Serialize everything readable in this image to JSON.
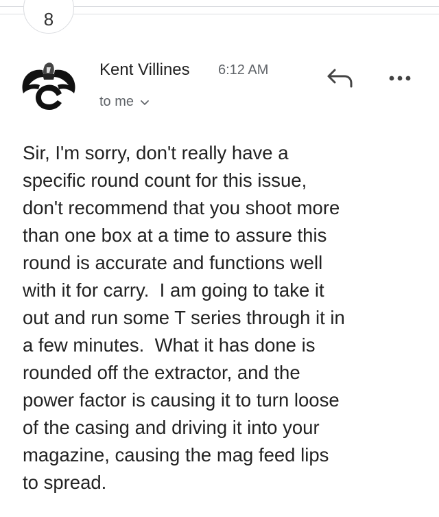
{
  "thread": {
    "collapsed_count": "8"
  },
  "message": {
    "sender_name": "Kent Villines",
    "time": "6:12 AM",
    "recipient": "to me",
    "reply_icon": "reply-arrow-icon",
    "more_icon": "more-horizontal-icon",
    "body_lines": [
      "Sir, I'm sorry, don't really have a",
      "specific round count for this issue,",
      "don't recommend that you shoot more",
      "than one box at a time to assure this",
      "round is accurate and functions well",
      "with it for carry.  I am going to take it",
      "out and run some T series through it in",
      "a few minutes.  What it has done is",
      "rounded off the extractor, and the",
      "power factor is causing it to turn loose",
      "of the casing and driving it into your",
      "magazine, causing the mag feed lips",
      "to spread."
    ]
  },
  "colors": {
    "text": "#222222",
    "secondary_text": "#5f6368",
    "divider": "#dadce0",
    "background": "#ffffff"
  }
}
